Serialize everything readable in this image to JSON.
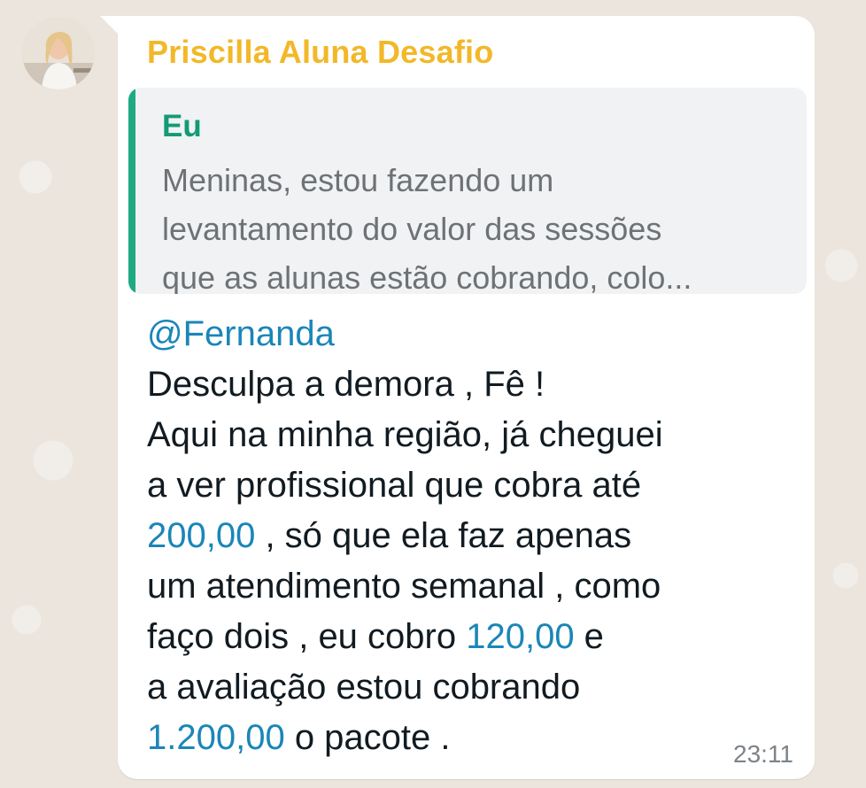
{
  "message": {
    "sender_name": "Priscilla Aluna Desafio",
    "quoted": {
      "author": "Eu",
      "lines": [
        "Meninas, estou fazendo um",
        "levantamento do valor das sessões",
        "que as alunas estão cobrando, colo..."
      ]
    },
    "mention": "@Fernanda",
    "body": {
      "line1": "Desculpa a demora , Fê !",
      "line2": "Aqui na minha região, já cheguei",
      "line3": "a ver profissional que cobra até",
      "line4_num": "200,00",
      "line4_rest": " , só que ela faz apenas",
      "line5": "um atendimento semanal , como",
      "line6_pre": "faço dois ,  eu cobro ",
      "line6_num": "120,00",
      "line6_post": " e",
      "line7": "a avaliação estou cobrando",
      "line8_num": "1.200,00",
      "line8_rest": " o pacote ."
    },
    "time": "23:11"
  },
  "colors": {
    "sender": "#f2b829",
    "quote_accent": "#1faa83",
    "link": "#1a86b8",
    "background": "#ebe5de"
  }
}
